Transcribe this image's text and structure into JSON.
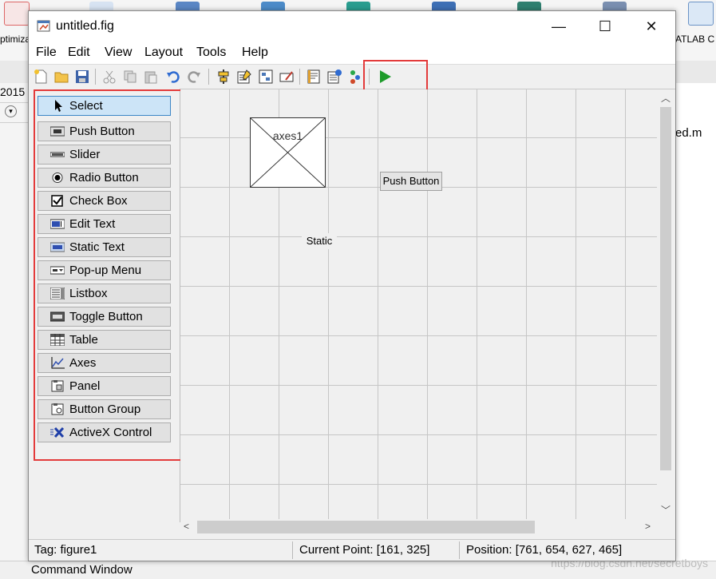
{
  "background": {
    "ribbon_labels": [
      "ptimiza",
      "ATLAB C"
    ],
    "left_row_label": "2015",
    "right_file_label": "ed.m",
    "command_window": "Command Window",
    "watermark": "https://blog.csdn.net/secretboys"
  },
  "window": {
    "title": "untitled.fig",
    "minimize": "—",
    "maximize": "☐",
    "close": "✕"
  },
  "menu": [
    "File",
    "Edit",
    "View",
    "Layout",
    "Tools",
    "Help"
  ],
  "toolbar": {
    "icons": [
      "new-file-icon",
      "open-folder-icon",
      "save-icon",
      "cut-icon",
      "copy-icon",
      "paste-icon",
      "undo-icon",
      "redo-icon",
      "align-icon",
      "menu-editor-icon",
      "tab-order-icon",
      "toolbar-editor-icon",
      "editor-icon",
      "property-inspector-icon",
      "object-browser-icon",
      "run-icon"
    ]
  },
  "palette": {
    "items": [
      {
        "label": "Select",
        "icon": "cursor-icon"
      },
      {
        "label": "Push Button",
        "icon": "ok-button-icon"
      },
      {
        "label": "Slider",
        "icon": "slider-icon"
      },
      {
        "label": "Radio Button",
        "icon": "radio-icon"
      },
      {
        "label": "Check Box",
        "icon": "checkbox-icon"
      },
      {
        "label": "Edit Text",
        "icon": "edit-text-icon"
      },
      {
        "label": "Static Text",
        "icon": "static-text-icon"
      },
      {
        "label": "Pop-up Menu",
        "icon": "popup-icon"
      },
      {
        "label": "Listbox",
        "icon": "listbox-icon"
      },
      {
        "label": "Toggle Button",
        "icon": "toggle-icon"
      },
      {
        "label": "Table",
        "icon": "table-icon"
      },
      {
        "label": "Axes",
        "icon": "axes-icon"
      },
      {
        "label": "Panel",
        "icon": "panel-icon"
      },
      {
        "label": "Button Group",
        "icon": "button-group-icon"
      },
      {
        "label": "ActiveX Control",
        "icon": "activex-icon"
      }
    ]
  },
  "canvas": {
    "axes_label": "axes1",
    "push_button_label": "Push Button",
    "static_label": "Static"
  },
  "status": {
    "tag": "Tag: figure1",
    "current_point": "Current Point:  [161, 325]",
    "position": "Position: [761, 654, 627, 465]"
  },
  "colors": {
    "highlight": "#e33b3b",
    "run_green": "#1e9b2b",
    "selected_bg": "#cce4f7"
  }
}
